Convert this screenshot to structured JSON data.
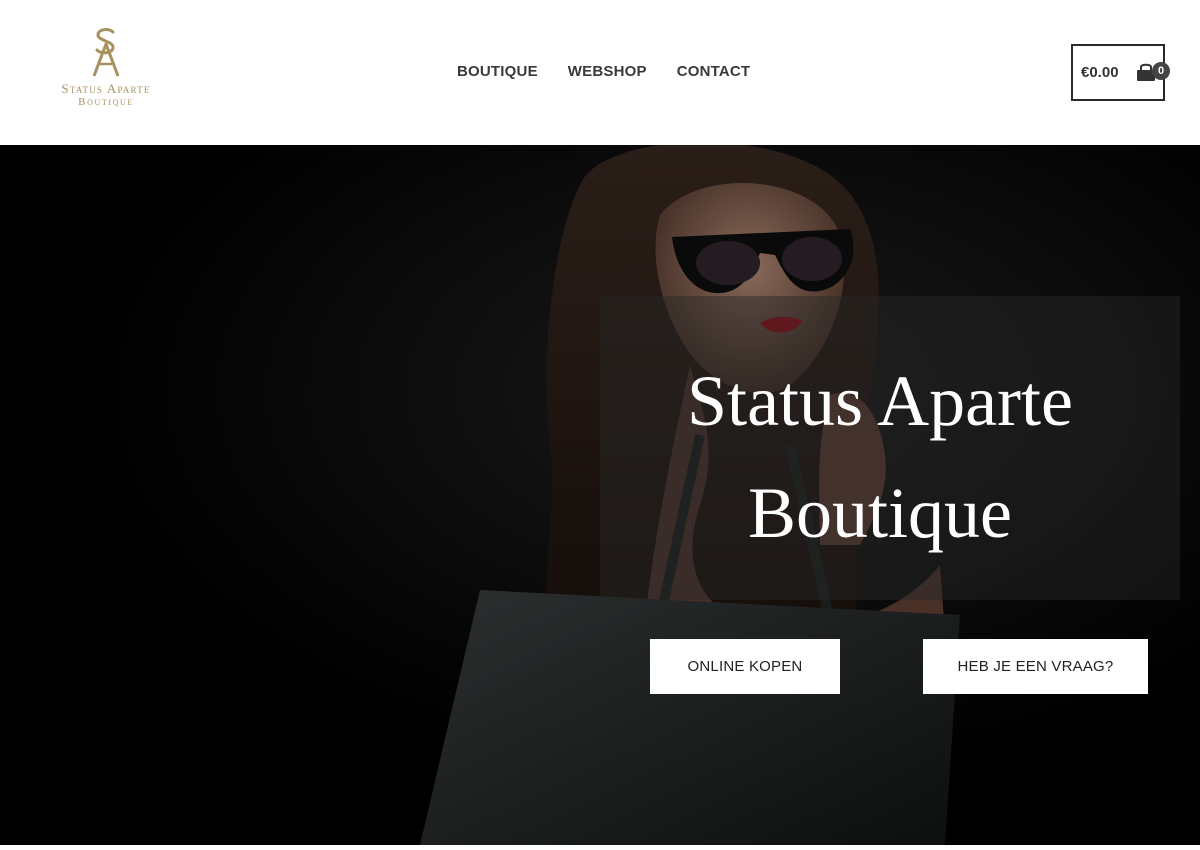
{
  "brand": {
    "name": "Status Aparte",
    "subtitle": "Boutique",
    "monogram": "SA",
    "color": "#a8915e"
  },
  "nav": {
    "items": [
      {
        "label": "BOUTIQUE"
      },
      {
        "label": "WEBSHOP"
      },
      {
        "label": "CONTACT"
      }
    ]
  },
  "cart": {
    "amount": "€0.00",
    "count": "0",
    "icon": "shopping-bag-icon"
  },
  "hero": {
    "title_line1": "Status Aparte",
    "title_line2": "Boutique",
    "buttons": {
      "shop": "ONLINE KOPEN",
      "ask": "HEB JE EEN VRAAG?"
    }
  }
}
